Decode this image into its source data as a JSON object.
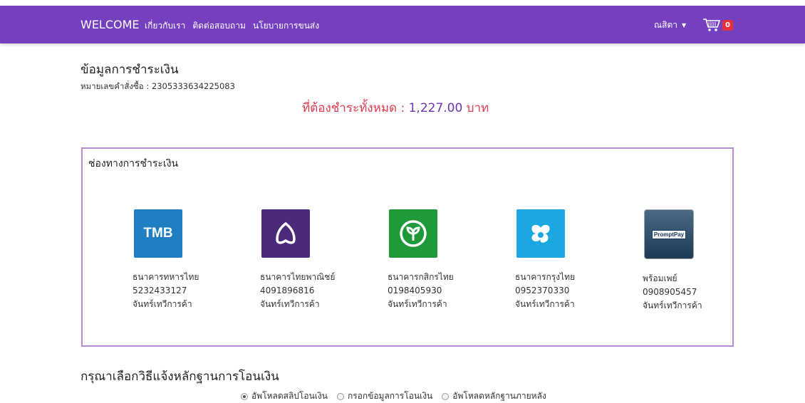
{
  "nav": {
    "brand": "WELCOME",
    "links": [
      "เกี่ยวกับเรา",
      "ติดต่อสอบถาม",
      "นโยบายการขนส่ง"
    ],
    "user": "ณสิตา",
    "cart_count": "0",
    "color": "#7440c0"
  },
  "payment": {
    "title": "ข้อมูลการชำระเงิน",
    "order_number": "หมายเลขคำสั่งซื้อ : 2305333634225083",
    "total_label": "ที่ต้องชำระทั้งหมด : ",
    "total_amount": "1,227.00",
    "total_unit": " บาท"
  },
  "channels": {
    "title": "ช่องทางการชำระเงิน",
    "banks": [
      {
        "name": "ธนาคารทหารไทย",
        "account": "5232433127",
        "holder": "จันทร์เทวีการค้า",
        "logo_text": "TMB",
        "color": "#1f7fc2",
        "icon": "tmb-logo-icon"
      },
      {
        "name": "ธนาคารไทยพาณิชย์",
        "account": "4091896816",
        "holder": "จันทร์เทวีการค้า",
        "color": "#4b2a7b",
        "icon": "scb-logo-icon"
      },
      {
        "name": "ธนาคารกสิกรไทย",
        "account": "0198405930",
        "holder": "จันทร์เทวีการค้า",
        "color": "#1e9a3a",
        "icon": "kbank-logo-icon"
      },
      {
        "name": "ธนาคารกรุงไทย",
        "account": "0952370330",
        "holder": "จันทร์เทวีการค้า",
        "color": "#1ba7e1",
        "icon": "ktb-logo-icon"
      },
      {
        "name": "พร้อมเพย์",
        "account": "0908905457",
        "holder": "จันทร์เทวีการค้า",
        "logo_text": "PromptPay",
        "color": "#1d3a55",
        "icon": "promptpay-logo-icon"
      }
    ]
  },
  "evidence": {
    "title": "กรุณาเลือกวิธีแจ้งหลักฐานการโอนเงิน",
    "options": [
      "อัพโหลดสลิปโอนเงิน",
      "กรอกข้อมูลการโอนเงิน",
      "อัพโหลดหลักฐานภายหลัง"
    ],
    "selected": 0
  }
}
